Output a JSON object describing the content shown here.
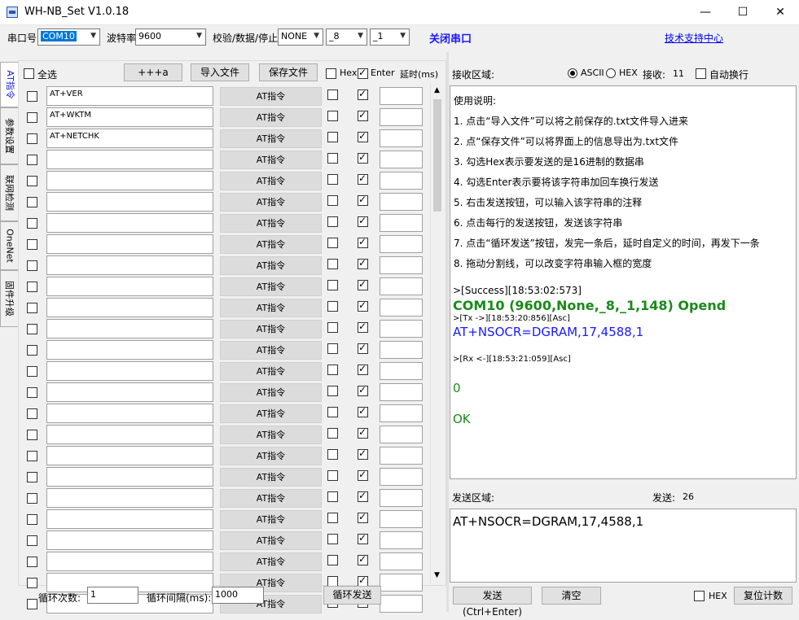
{
  "window": {
    "title": "WH-NB_Set V1.0.18",
    "minimize": "—",
    "maximize": "☐",
    "close": "✕"
  },
  "toolbar": {
    "port_label": "串口号",
    "port_value": "COM10",
    "baud_label": "波特率",
    "baud_value": "9600",
    "parity_label": "校验/数据/停止",
    "parity_value": "NONE",
    "data_value": "_8",
    "stop_value": "_1",
    "close_port": "关闭串口",
    "support": "技术支持中心"
  },
  "side_tabs": [
    "AT指令",
    "参数设置",
    "联网检测",
    "OneNet",
    "固件升级"
  ],
  "left": {
    "select_all": "全选",
    "plus_button": "+++a",
    "import_button": "导入文件",
    "save_button": "保存文件",
    "hex_label": "Hex",
    "enter_label": "Enter",
    "delay_label": "延时(ms)",
    "at_button": "AT指令",
    "commands": [
      "AT+VER",
      "AT+WKTM",
      "AT+NETCHK",
      "",
      "",
      "",
      "",
      "",
      "",
      "",
      "",
      "",
      "",
      "",
      "",
      "",
      "",
      "",
      "",
      "",
      "",
      "",
      "",
      "",
      ""
    ],
    "loop_count_label": "循环次数:",
    "loop_count_value": "1",
    "loop_interval_label": "循环间隔(ms):",
    "loop_interval_value": "1000",
    "loop_send_button": "循环发送"
  },
  "receive": {
    "title": "接收区域:",
    "ascii_label": "ASCII",
    "hex_label": "HEX",
    "count_label": "接收:",
    "count_value": "11",
    "auto_wrap": "自动换行",
    "help": [
      "使用说明:",
      "1. 点击“导入文件”可以将之前保存的.txt文件导入进来",
      "2. 点“保存文件”可以将界面上的信息导出为.txt文件",
      "3. 勾选Hex表示要发送的是16进制的数据串",
      "4. 勾选Enter表示要将该字符串加回车换行发送",
      "5. 右击发送按钮，可以输入该字符串的注释",
      "6. 点击每行的发送按钮，发送该字符串",
      "7. 点击“循环发送”按钮，发完一条后，延时自定义的时间，再发下一条",
      "8. 拖动分割线，可以改变字符串输入框的宽度"
    ],
    "log_success": ">[Success][18:53:02:573]",
    "log_open": "COM10 (9600,None,_8,_1,148) Opend",
    "log_tx": ">[Tx ->][18:53:20:856][Asc]",
    "log_tx_cmd": "AT+NSOCR=DGRAM,17,4588,1",
    "log_rx": ">[Rx <-][18:53:21:059][Asc]",
    "log_rx_val": "0",
    "log_rx_ok": "OK"
  },
  "send": {
    "title": "发送区域:",
    "count_label": "发送:",
    "count_value": "26",
    "content": "AT+NSOCR=DGRAM,17,4588,1",
    "send_button": "发送(Ctrl+Enter)",
    "clear_button": "清空",
    "hex_label": "HEX",
    "reset_button": "复位计数"
  },
  "colors": {
    "accent_blue": "#1a1aff",
    "green": "#1a8a1a",
    "selection": "#0078d7"
  }
}
